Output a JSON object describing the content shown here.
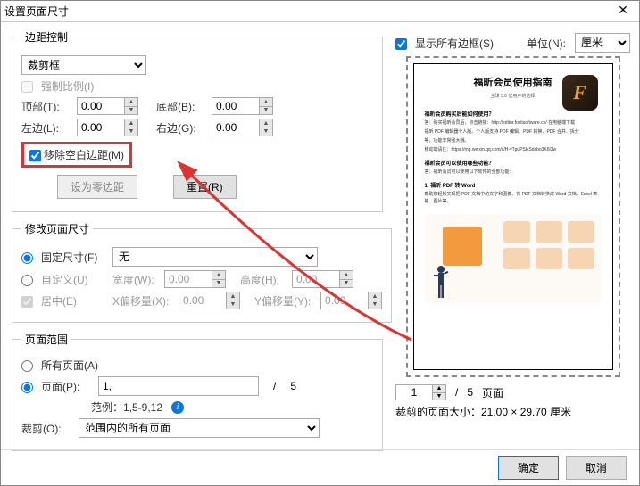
{
  "dialog": {
    "title": "设置页面尺寸"
  },
  "margin": {
    "legend": "边距控制",
    "box_type": "裁剪框",
    "force_ratio": "强制比例(I)",
    "top_label": "顶部(T):",
    "top": "0.00",
    "bottom_label": "底部(B):",
    "bottom": "0.00",
    "left_label": "左边(L):",
    "left": "0.00",
    "right_label": "右边(G):",
    "right": "0.00",
    "remove_white": "移除空白边距(M)",
    "zero_btn": "设为零边距",
    "reset_btn": "重置(R)"
  },
  "pagesize": {
    "legend": "修改页面尺寸",
    "fixed_label": "固定尺寸(F)",
    "fixed_value": "无",
    "custom_label": "自定义(U)",
    "width_label": "宽度(W):",
    "width": "0.00",
    "height_label": "高度(H):",
    "height": "0.00",
    "center_label": "居中(E)",
    "xoff_label": "X偏移量(X):",
    "xoff": "0.00",
    "yoff_label": "Y偏移量(Y):",
    "yoff": "0.00"
  },
  "range": {
    "legend": "页面范围",
    "all_label": "所有页面(A)",
    "pages_label": "页面(P):",
    "pages_value": "1,",
    "total": "5",
    "example": "范例：1,5-9,12",
    "crop_label": "裁剪(O):",
    "crop_value": "范围内的所有页面"
  },
  "rightpane": {
    "show_all": "显示所有边框(S)",
    "unit_label": "单位(N):",
    "unit_value": "厘米",
    "nav_current": "1",
    "nav_total": "5",
    "nav_pages": "页面",
    "crop_info": "裁剪的页面大小：21.00 × 29.70 厘米"
  },
  "preview": {
    "title": "福昕会员使用指南",
    "sub": "全球 5.6 亿用户的选择",
    "q1": "福昕会员购买后能如何使用？",
    "a1a": "答：购买福昕会员后，点击链接：http://editor.foxitsoftware.cn/ 在电脑端下载",
    "a1b": "福昕 PDF 编辑器个人版。个人版支持 PDF 编辑、PDF 转换、PDF 合并、拆分",
    "a1c": "等，功能非常强大哦。",
    "a1d": "移动端请往：https://mp.weixin.qq.com/s/H-vTpuPSlcSdcbo3K6l3w",
    "q2": "福昕会员可以使用哪些功能？",
    "a2": "答：福昕会员可以使用以下软件的全部功能：",
    "b1": "1. 福昕 PDF 转 Word",
    "b2": "帮助您轻松实现把 PDF 文档中的文字和图像、将 PDF 文档转换成 Word 文档、Excel 表格、图片等。"
  },
  "footer": {
    "ok": "确定",
    "cancel": "取消"
  }
}
